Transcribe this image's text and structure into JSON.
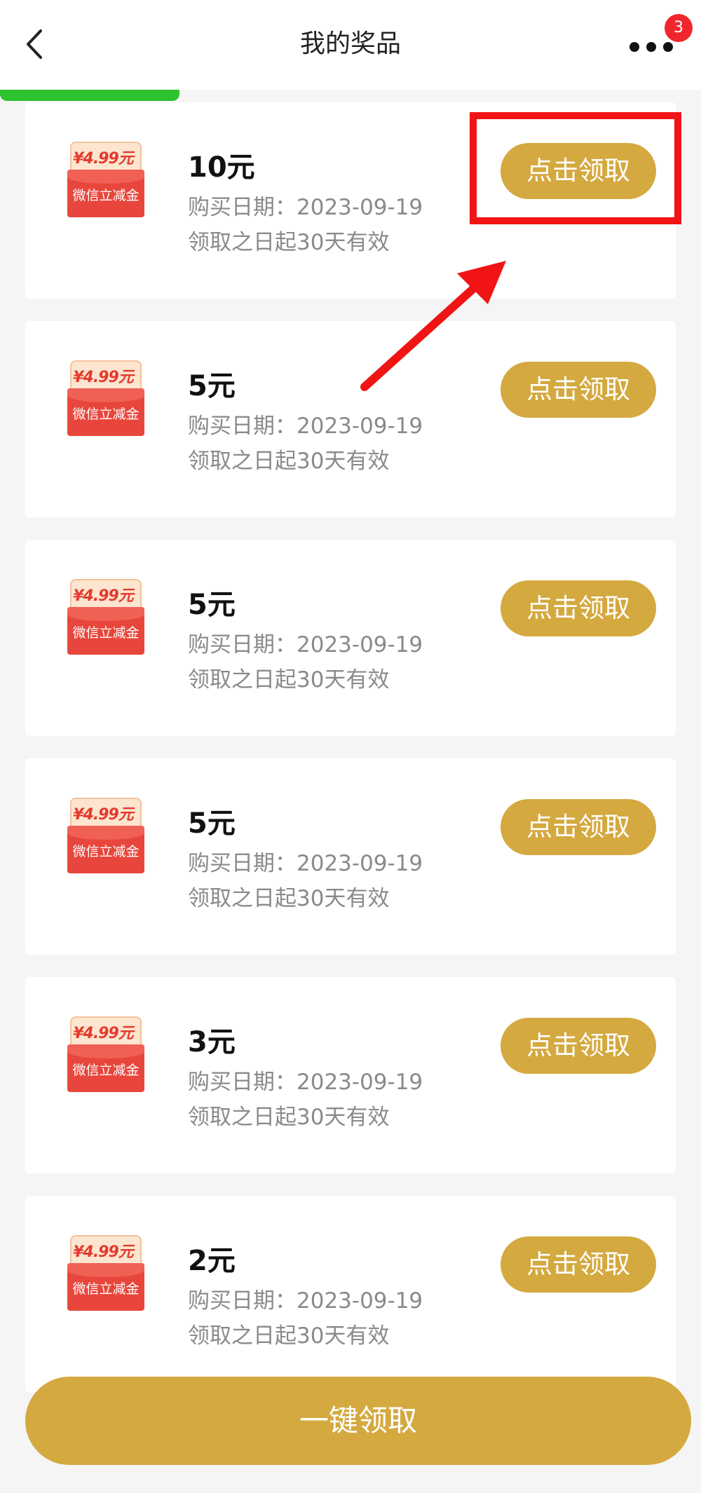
{
  "header": {
    "title": "我的奖品",
    "badge_count": "3"
  },
  "coupon_art": {
    "price": "¥4.99元",
    "label": "微信立减金"
  },
  "prizes": [
    {
      "amount": "10元",
      "purchase_date": "购买日期：2023-09-19",
      "validity": "领取之日起30天有效",
      "button": "点击领取"
    },
    {
      "amount": "5元",
      "purchase_date": "购买日期：2023-09-19",
      "validity": "领取之日起30天有效",
      "button": "点击领取"
    },
    {
      "amount": "5元",
      "purchase_date": "购买日期：2023-09-19",
      "validity": "领取之日起30天有效",
      "button": "点击领取"
    },
    {
      "amount": "5元",
      "purchase_date": "购买日期：2023-09-19",
      "validity": "领取之日起30天有效",
      "button": "点击领取"
    },
    {
      "amount": "3元",
      "purchase_date": "购买日期：2023-09-19",
      "validity": "领取之日起30天有效",
      "button": "点击领取"
    },
    {
      "amount": "2元",
      "purchase_date": "购买日期：2023-09-19",
      "validity": "领取之日起30天有效",
      "button": "点击领取"
    }
  ],
  "footer": {
    "claim_all_label": "一键领取"
  },
  "colors": {
    "accent_gold": "#d4a93f",
    "highlight_red": "#f01414",
    "tab_green": "#2ec22e"
  }
}
